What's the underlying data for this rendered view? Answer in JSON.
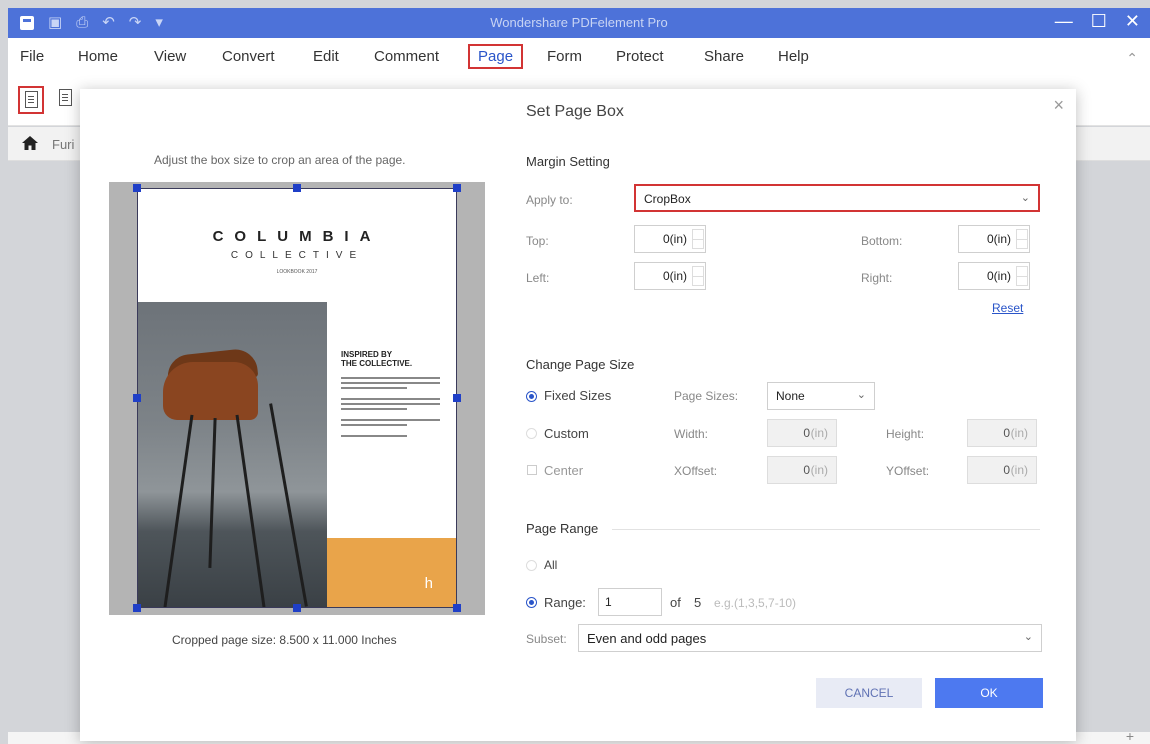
{
  "window": {
    "title": "Wondershare PDFelement Pro",
    "controls": [
      "—",
      "☐",
      "✕"
    ]
  },
  "menu": {
    "items": [
      "File",
      "Home",
      "View",
      "Convert",
      "Edit",
      "Comment",
      "Page",
      "Form",
      "Protect",
      "Share",
      "Help"
    ],
    "active": "Page"
  },
  "tabs": {
    "current": "Furi"
  },
  "dialog": {
    "title": "Set Page Box",
    "close": "×",
    "preview": {
      "caption": "Adjust the box size to crop an area of the page.",
      "cropped_size": "Cropped page size: 8.500 x 11.000 Inches",
      "page": {
        "brand": "COLUMBIA",
        "brand_sub": "COLLECTIVE",
        "brand_tiny": "LOOKBOOK 2017",
        "headline_1": "INSPIRED BY",
        "headline_2": "THE COLLECTIVE.",
        "logo_mark": "h"
      }
    },
    "margin": {
      "title": "Margin Setting",
      "apply_label": "Apply to:",
      "apply_value": "CropBox",
      "top_label": "Top:",
      "top_value": "0(in)",
      "bottom_label": "Bottom:",
      "bottom_value": "0(in)",
      "left_label": "Left:",
      "left_value": "0(in)",
      "right_label": "Right:",
      "right_value": "0(in)",
      "reset": "Reset"
    },
    "page_size": {
      "title": "Change Page Size",
      "fixed_label": "Fixed Sizes",
      "page_sizes_label": "Page Sizes:",
      "page_sizes_value": "None",
      "custom_label": "Custom",
      "width_label": "Width:",
      "width_value": "0",
      "height_label": "Height:",
      "height_value": "0",
      "center_label": "Center",
      "xoffset_label": "XOffset:",
      "xoffset_value": "0",
      "yoffset_label": "YOffset:",
      "yoffset_value": "0",
      "unit": "(in)"
    },
    "page_range": {
      "title": "Page Range",
      "all_label": "All",
      "range_label": "Range:",
      "range_value": "1",
      "of_label": "of",
      "total": "5",
      "example": "e.g.(1,3,5,7-10)",
      "subset_label": "Subset:",
      "subset_value": "Even and odd pages"
    },
    "buttons": {
      "cancel": "CANCEL",
      "ok": "OK"
    }
  },
  "icons": [
    "app-logo-icon",
    "save-icon",
    "print-icon",
    "undo-icon",
    "redo-icon",
    "quick-access-dropdown-icon",
    "home-icon",
    "crop-page-icon",
    "extract-page-icon",
    "chevron-up-icon"
  ]
}
